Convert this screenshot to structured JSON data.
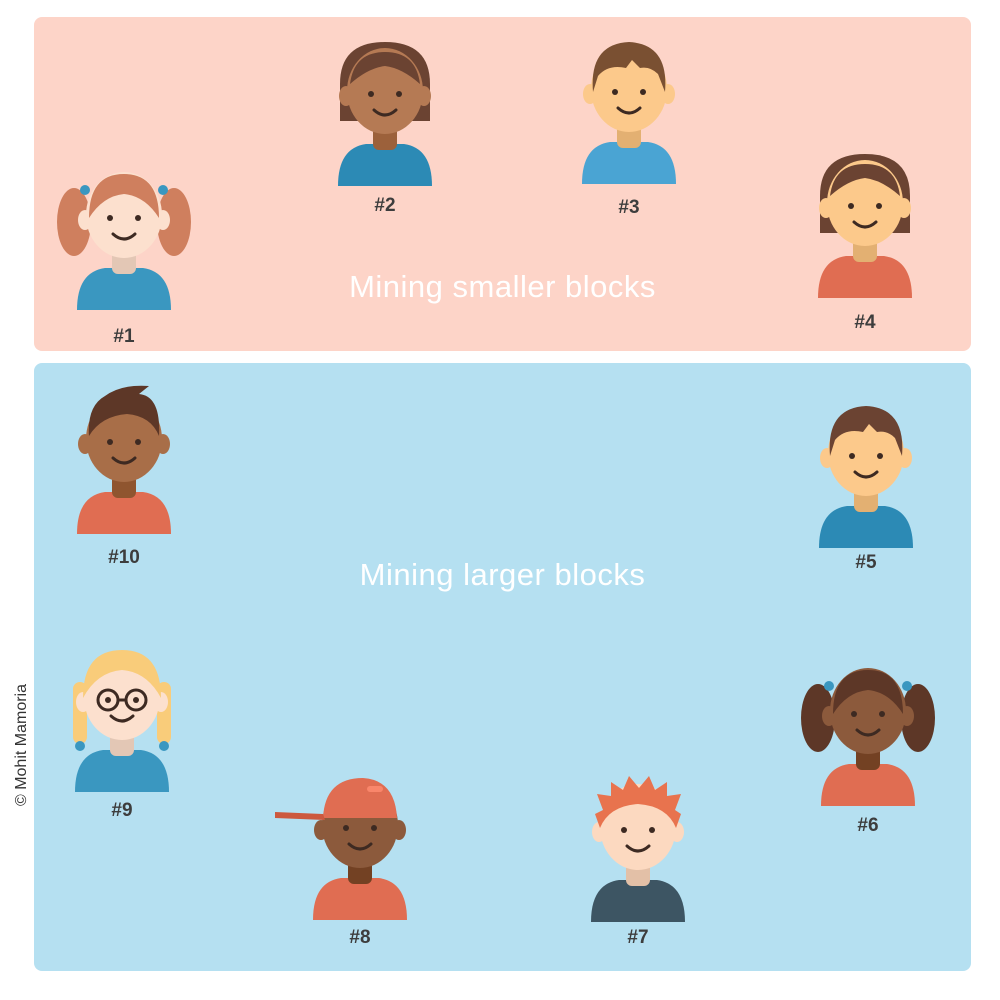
{
  "groups": {
    "smaller": {
      "label": "Mining smaller blocks"
    },
    "larger": {
      "label": "Mining larger blocks"
    }
  },
  "miners": [
    {
      "label": "#1",
      "group": "smaller",
      "hair": "#cf7f5e",
      "skin": "#fce0ce",
      "shirt": "#3a97c0",
      "style": "pigtails"
    },
    {
      "label": "#2",
      "group": "smaller",
      "hair": "#6b4332",
      "skin": "#b57a54",
      "shirt": "#2c8ab5",
      "style": "bob"
    },
    {
      "label": "#3",
      "group": "smaller",
      "hair": "#7a5032",
      "skin": "#fcc98b",
      "shirt": "#4aa4d3",
      "style": "short"
    },
    {
      "label": "#4",
      "group": "smaller",
      "hair": "#6b4332",
      "skin": "#fcc98b",
      "shirt": "#e06d52",
      "style": "bob"
    },
    {
      "label": "#5",
      "group": "larger",
      "hair": "#6b4332",
      "skin": "#fcc98b",
      "shirt": "#2c8ab5",
      "style": "short"
    },
    {
      "label": "#6",
      "group": "larger",
      "hair": "#5d3727",
      "skin": "#8c5a3c",
      "shirt": "#e06d52",
      "style": "pigtails"
    },
    {
      "label": "#7",
      "group": "larger",
      "hair": "#e8734e",
      "skin": "#fcd9c0",
      "shirt": "#3d5563",
      "style": "spiky"
    },
    {
      "label": "#8",
      "group": "larger",
      "hair": "#e06d52",
      "skin": "#8c5a3c",
      "shirt": "#e06d52",
      "style": "cap"
    },
    {
      "label": "#9",
      "group": "larger",
      "hair": "#f9cc7a",
      "skin": "#fce0ce",
      "shirt": "#3a97c0",
      "style": "braids"
    },
    {
      "label": "#10",
      "group": "larger",
      "hair": "#5d3727",
      "skin": "#a86e48",
      "shirt": "#e06d52",
      "style": "quiff"
    }
  ],
  "credit": "© Mohit Mamoria"
}
